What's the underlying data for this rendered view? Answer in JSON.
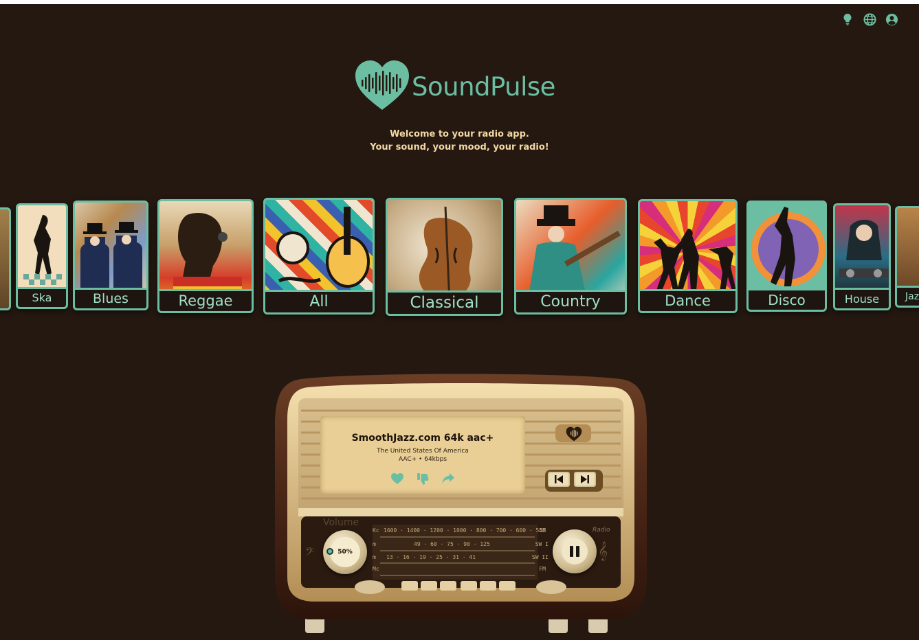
{
  "brand": {
    "name": "SoundPulse",
    "color": "#6cbea2"
  },
  "welcome": {
    "line1": "Welcome to your radio app.",
    "line2": "Your sound, your mood, your radio!"
  },
  "top_icons": [
    "lightbulb-icon",
    "globe-icon",
    "user-icon"
  ],
  "genres": [
    {
      "label": "Ska"
    },
    {
      "label": "Blues"
    },
    {
      "label": "Reggae"
    },
    {
      "label": "All"
    },
    {
      "label": "Classical"
    },
    {
      "label": "Country"
    },
    {
      "label": "Dance"
    },
    {
      "label": "Disco"
    },
    {
      "label": "House"
    },
    {
      "label": "Jazz"
    }
  ],
  "player": {
    "station_name": "SmoothJazz.com 64k aac+",
    "country": "The United States Of America",
    "bitrate": "AAC+ • 64kbps",
    "volume_label": "Volume",
    "volume_value": "50%",
    "radio_badge": "Radio",
    "dial": {
      "kc_label": "Kc",
      "kc_values": "1600 · 1400 · 1200 · 1000 · 800 · 700 · 600 · 550",
      "am_label": "AM",
      "m_label": "m",
      "sw1_values": "49 · 60 · 75 · 90 · 125",
      "sw1_label": "SW I",
      "m2_label": "m",
      "sw2_values": "13 · 16 · 19 · 25 · 31 · 41",
      "sw2_label": "SW II",
      "mc_label": "Mc",
      "fm_label": "FM"
    }
  }
}
